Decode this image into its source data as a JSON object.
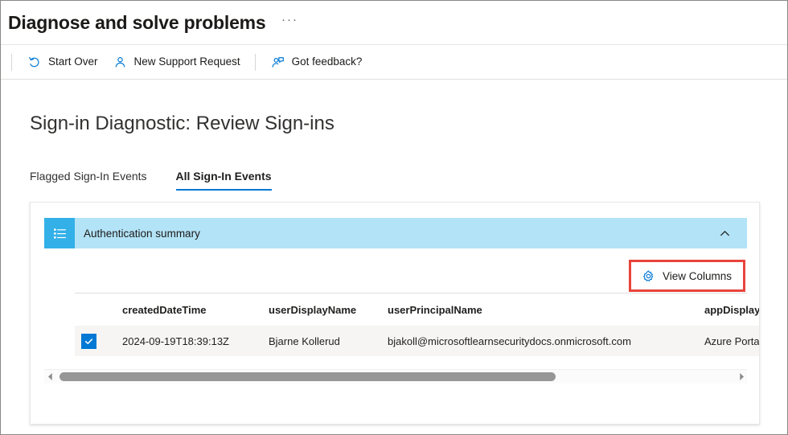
{
  "titlebar": {
    "title": "Diagnose and solve problems",
    "more_label": "···"
  },
  "commandbar": {
    "buttons": [
      {
        "label": "Start Over",
        "icon": "restart-icon"
      },
      {
        "label": "New Support Request",
        "icon": "person-icon"
      },
      {
        "label": "Got feedback?",
        "icon": "feedback-person-icon"
      }
    ]
  },
  "main": {
    "heading": "Sign-in Diagnostic: Review Sign-ins",
    "tabs": [
      {
        "label": "Flagged Sign-In Events",
        "selected": false
      },
      {
        "label": "All Sign-In Events",
        "selected": true
      }
    ],
    "section": {
      "title": "Authentication summary",
      "icon": "list-summary-icon",
      "collapse_icon": "chevron-up-icon",
      "header_bg": "#b3e3f7",
      "icon_bg": "#32b0e7"
    },
    "toolbar": {
      "view_columns_label": "View Columns",
      "view_columns_icon": "gear-icon",
      "highlight_color": "#e8443c"
    },
    "grid": {
      "columns": [
        "createdDateTime",
        "userDisplayName",
        "userPrincipalName",
        "appDisplayName"
      ],
      "rows": [
        {
          "selected": true,
          "createdDateTime": "2024-09-19T18:39:13Z",
          "userDisplayName": "Bjarne Kollerud",
          "userPrincipalName": "bjakoll@microsoftlearnsecuritydocs.onmicrosoft.com",
          "appDisplayName": "Azure Portal"
        }
      ]
    },
    "scrollbar": {
      "left_arrow": "scroll-left-arrow",
      "right_arrow": "scroll-right-arrow"
    }
  },
  "colors": {
    "accent": "#0078d4",
    "row_bg": "#f6f5f4"
  }
}
